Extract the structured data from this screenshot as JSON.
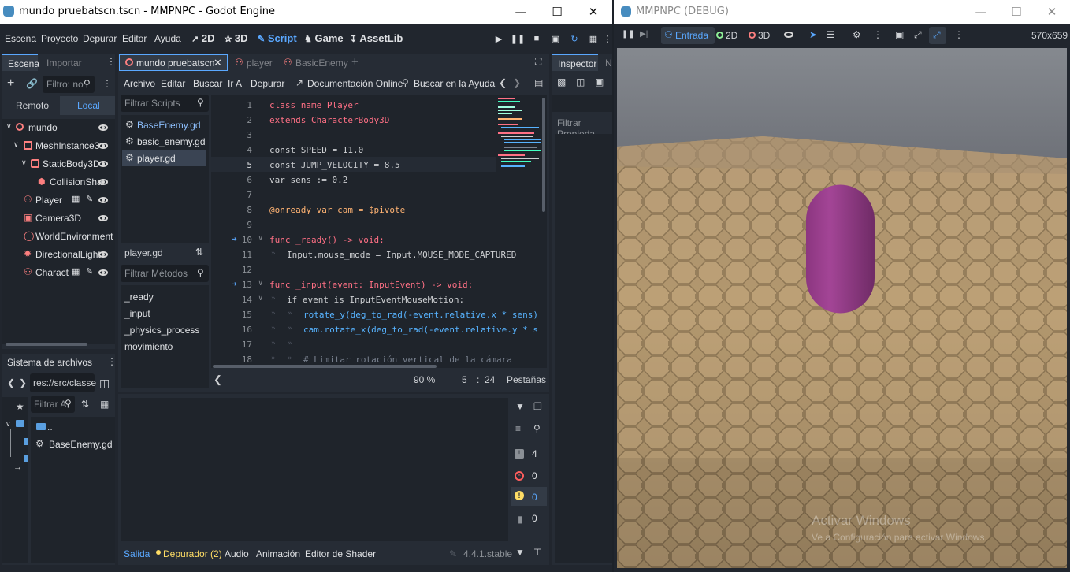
{
  "editor_window": {
    "title": "mundo pruebatscn.tscn - MMPNPC - Godot Engine",
    "menus": [
      "Escena",
      "Proyecto",
      "Depurar",
      "Editor",
      "Ayuda"
    ],
    "workspaces": [
      "2D",
      "3D",
      "Script",
      "Game",
      "AssetLib"
    ],
    "active_workspace": "Script"
  },
  "scene_dock": {
    "tabs": [
      "Escena",
      "Importar"
    ],
    "filter_placeholder": "Filtro: no",
    "remote_label": "Remoto",
    "local_label": "Local",
    "nodes": [
      {
        "name": "mundo",
        "depth": 0,
        "icon": "node3d-icon"
      },
      {
        "name": "MeshInstance3",
        "depth": 1,
        "icon": "mesh-icon"
      },
      {
        "name": "StaticBody3D",
        "depth": 2,
        "icon": "staticbody-icon"
      },
      {
        "name": "CollisionSha",
        "depth": 3,
        "icon": "collision-icon"
      },
      {
        "name": "Player",
        "depth": 1,
        "icon": "character-icon"
      },
      {
        "name": "Camera3D",
        "depth": 1,
        "icon": "camera-icon"
      },
      {
        "name": "WorldEnvironment",
        "depth": 1,
        "icon": "environment-icon"
      },
      {
        "name": "DirectionalLight",
        "depth": 1,
        "icon": "light-icon"
      },
      {
        "name": "Charact",
        "depth": 1,
        "icon": "character-icon"
      }
    ]
  },
  "filesystem_dock": {
    "title": "Sistema de archivos",
    "path": "res://src/classe",
    "filter_placeholder": "Filtrar A",
    "items": [
      "..",
      "BaseEnemy.gd"
    ]
  },
  "script_tabs": [
    "mundo pruebatscn",
    "player",
    "BasicEnemy"
  ],
  "script_menu": [
    "Archivo",
    "Editar",
    "Buscar",
    "Ir A",
    "Depurar",
    "Documentación Online",
    "Buscar en la Ayuda"
  ],
  "scripts_panel": {
    "filter_placeholder": "Filtrar Scripts",
    "scripts": [
      "BaseEnemy.gd",
      "basic_enemy.gd",
      "player.gd"
    ],
    "current_script": "player.gd",
    "methods_filter_placeholder": "Filtrar Métodos",
    "methods": [
      "_ready",
      "_input",
      "_physics_process",
      "movimiento"
    ]
  },
  "code": {
    "line_numbers": [
      "1",
      "2",
      "3",
      "4",
      "5",
      "6",
      "7",
      "8",
      "9",
      "10",
      "11",
      "12",
      "13",
      "14",
      "15",
      "16",
      "17",
      "18"
    ],
    "lines": [
      "class_name Player",
      "extends CharacterBody3D",
      "",
      "const SPEED = 11.0",
      "const JUMP_VELOCITY = 8.5",
      "var sens := 0.2",
      "",
      "@onready var cam = $pivote",
      "",
      "func _ready() -> void:",
      "Input.mouse_mode = Input.MOUSE_MODE_CAPTURED",
      "",
      "func _input(event: InputEvent) -> void:",
      "if event is InputEventMouseMotion:",
      "rotate_y(deg_to_rad(-event.relative.x * sens)",
      "cam.rotate_x(deg_to_rad(-event.relative.y * s",
      "",
      "# Limitar rotación vertical de la cámara"
    ],
    "zoom": "90 %",
    "line": "5",
    "column": "24",
    "indent_mode": "Pestañas"
  },
  "inspector": {
    "tab": "Inspector",
    "tab2": "N",
    "filter_placeholder": "Filtrar Propieda"
  },
  "bottom_panel": {
    "tabs": [
      "Salida",
      "Depurador (2)",
      "Audio",
      "Animación",
      "Editor de Shader"
    ],
    "version": "4.4.1.stable",
    "counts": [
      "4",
      "0",
      "0",
      "0"
    ]
  },
  "debug_window": {
    "title": "MMPNPC (DEBUG)",
    "input_label": "Entrada",
    "mode_2d": "2D",
    "mode_3d": "3D",
    "resolution": "570x659",
    "watermark_line1": "Activar Windows",
    "watermark_line2": "Ve a Configuración para activar Windows.",
    "colors": {
      "capsule": "#9c3f8e",
      "sky": "#7b7f86",
      "floor": "#b3976c"
    }
  }
}
